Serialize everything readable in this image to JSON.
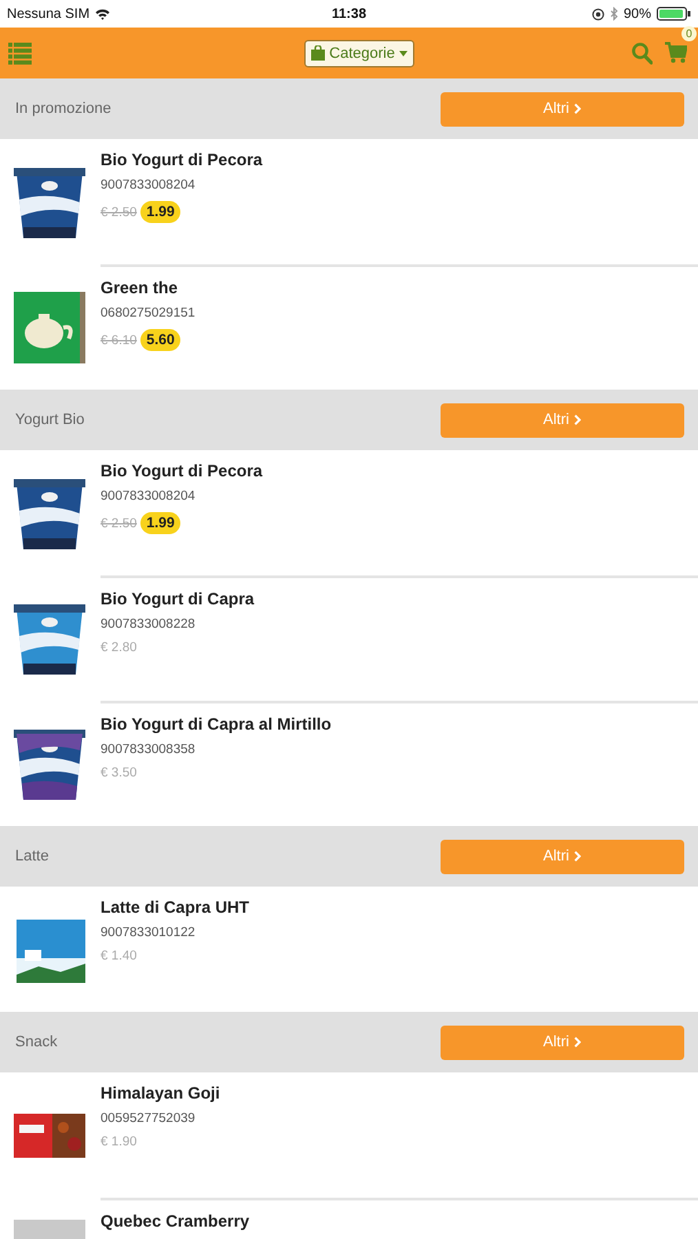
{
  "status_bar": {
    "carrier": "Nessuna SIM",
    "time": "11:38",
    "battery": "90%"
  },
  "header": {
    "categories_button": "Categorie",
    "cart_count": "0"
  },
  "sections": [
    {
      "title": "In promozione",
      "more_button": "Altri",
      "products": [
        {
          "name": "Bio Yogurt di Pecora",
          "code": "9007833008204",
          "old_price": "€ 2.50",
          "price": "1.99",
          "on_sale": true
        },
        {
          "name": "Green the",
          "code": "0680275029151",
          "old_price": "€ 6.10",
          "price": "5.60",
          "on_sale": true
        }
      ]
    },
    {
      "title": "Yogurt Bio",
      "more_button": "Altri",
      "products": [
        {
          "name": "Bio Yogurt di Pecora",
          "code": "9007833008204",
          "old_price": "€ 2.50",
          "price": "1.99",
          "on_sale": true
        },
        {
          "name": "Bio Yogurt di Capra",
          "code": "9007833008228",
          "price": "€ 2.80",
          "on_sale": false
        },
        {
          "name": "Bio Yogurt di Capra al Mirtillo",
          "code": "9007833008358",
          "price": "€ 3.50",
          "on_sale": false
        }
      ]
    },
    {
      "title": "Latte",
      "more_button": "Altri",
      "products": [
        {
          "name": "Latte di Capra UHT",
          "code": "9007833010122",
          "price": "€ 1.40",
          "on_sale": false
        }
      ]
    },
    {
      "title": "Snack",
      "more_button": "Altri",
      "products": [
        {
          "name": "Himalayan Goji",
          "code": "0059527752039",
          "price": "€ 1.90",
          "on_sale": false
        },
        {
          "name": "Quebec Cramberry"
        }
      ]
    }
  ]
}
